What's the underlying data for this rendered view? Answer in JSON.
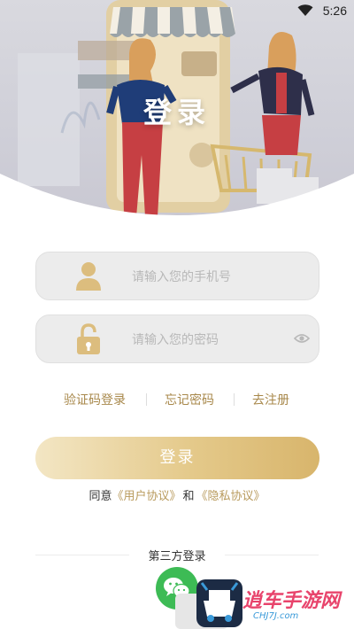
{
  "status_bar": {
    "time": "5:26",
    "wifi_icon": "wifi-icon"
  },
  "hero": {
    "title": "登录"
  },
  "phone_field": {
    "placeholder": "请输入您的手机号",
    "icon": "user-icon"
  },
  "password_field": {
    "placeholder": "请输入您的密码",
    "icon": "lock-icon",
    "toggle_icon": "eye-icon"
  },
  "links": {
    "sms_login": "验证码登录",
    "forgot_password": "忘记密码",
    "register": "去注册"
  },
  "login_button": {
    "label": "登录"
  },
  "agreement": {
    "prefix": "同意",
    "user_agreement": "《用户协议》",
    "connector": "和",
    "privacy_policy": "《隐私协议》"
  },
  "third_party": {
    "label": "第三方登录",
    "wechat_icon": "wechat-icon"
  },
  "watermark": {
    "text": "逍车手游网",
    "url": "CHJ7J.com"
  },
  "colors": {
    "accent": "#a8884b",
    "field_bg": "#ececec",
    "button_start": "#f3e6c4",
    "button_end": "#d8b56c",
    "icon_gold": "#dcbd7e",
    "wechat_green": "#3dbb55"
  }
}
